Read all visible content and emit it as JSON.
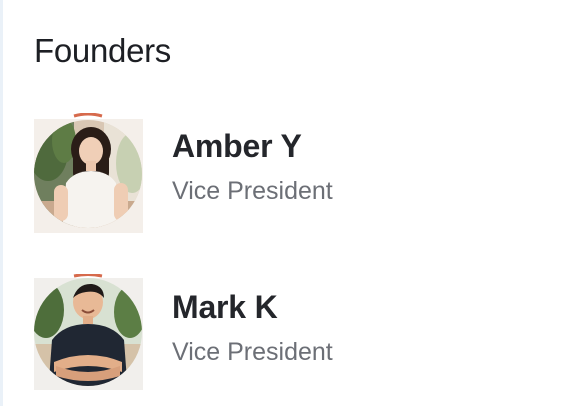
{
  "section": {
    "title": "Founders"
  },
  "founders": [
    {
      "name": "Amber Y",
      "role": "Vice President",
      "avatar_icon": "person-photo-icon"
    },
    {
      "name": "Mark K",
      "role": "Vice President",
      "avatar_icon": "person-photo-icon"
    }
  ],
  "colors": {
    "title": "#1d1f24",
    "name": "#24262b",
    "role": "#6c6f76"
  }
}
